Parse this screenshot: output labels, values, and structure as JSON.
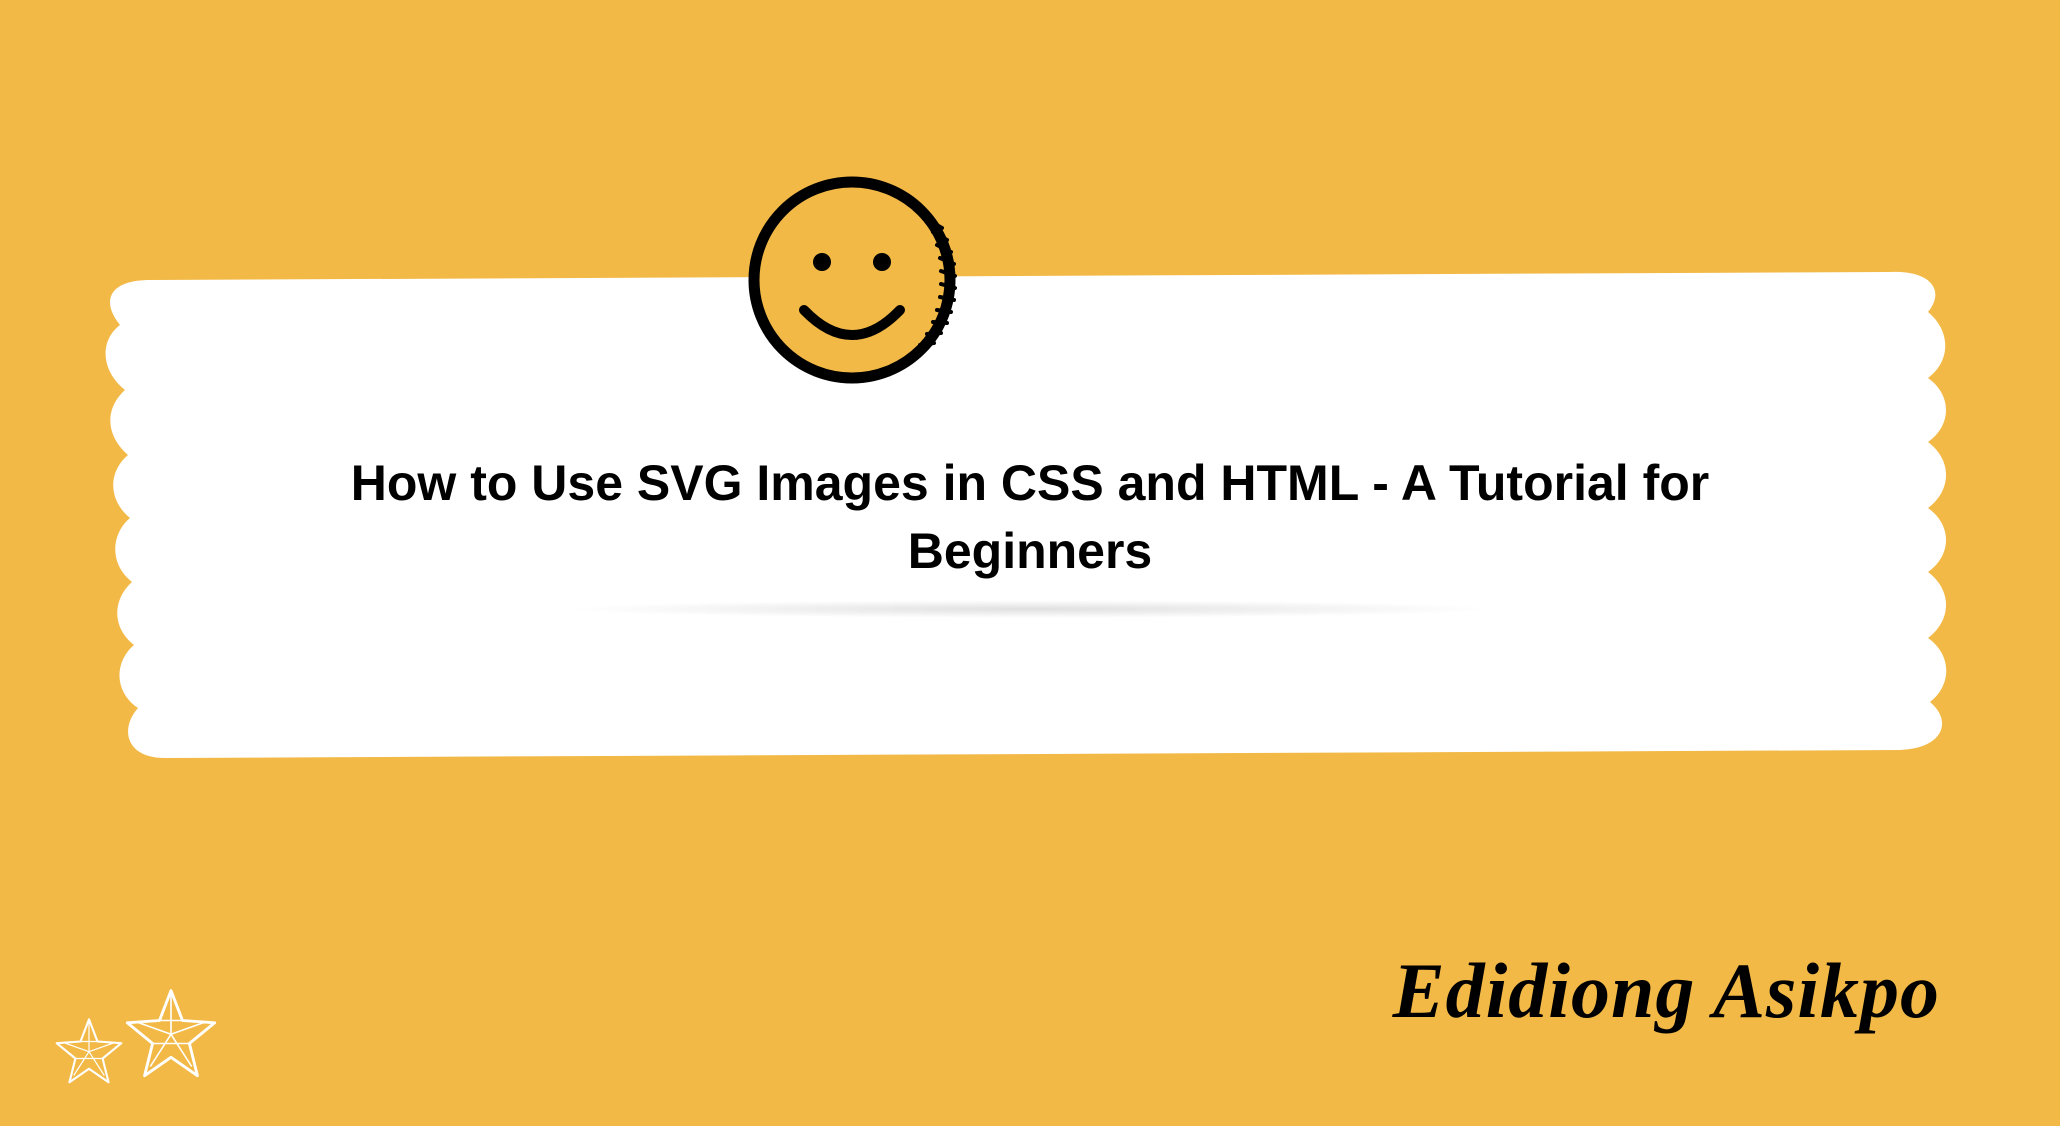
{
  "title": "How to Use SVG Images in CSS and HTML - A Tutorial for Beginners",
  "author": "Edidiong Asikpo",
  "icons": {
    "smiley": "smiley-icon",
    "stars": "stars-icon"
  },
  "colors": {
    "background": "#f2b946",
    "brush": "#ffffff",
    "text": "#000000"
  }
}
